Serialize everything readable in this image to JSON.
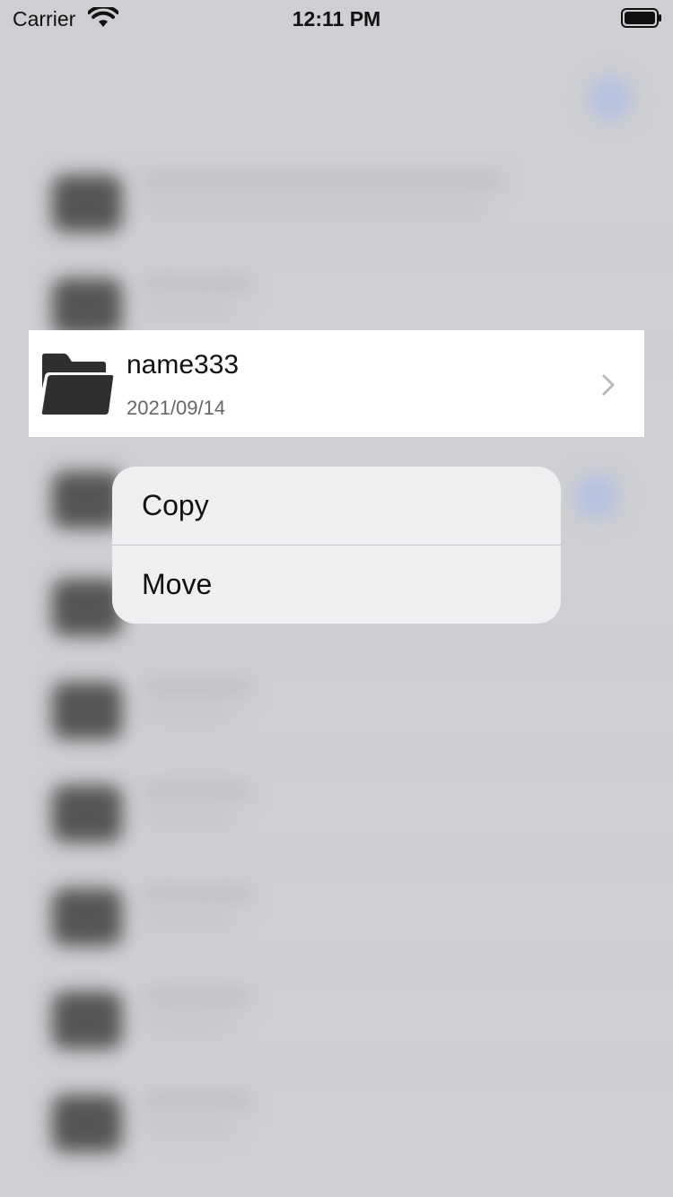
{
  "status_bar": {
    "carrier": "Carrier",
    "time": "12:11 PM",
    "wifi_icon": "wifi-icon",
    "battery_icon": "battery-full-icon"
  },
  "focused_item": {
    "title": "name333",
    "date": "2021/09/14",
    "icon": "folder-icon",
    "accessory": "chevron-right-icon"
  },
  "context_menu": {
    "items": [
      {
        "label": "Copy"
      },
      {
        "label": "Move"
      }
    ]
  },
  "colors": {
    "backdrop": "#cfcfd3",
    "menu_background": "#efeff1",
    "folder_icon": "#2f2f2f",
    "separator": "#c7c7cc",
    "secondary_text": "#666666"
  }
}
